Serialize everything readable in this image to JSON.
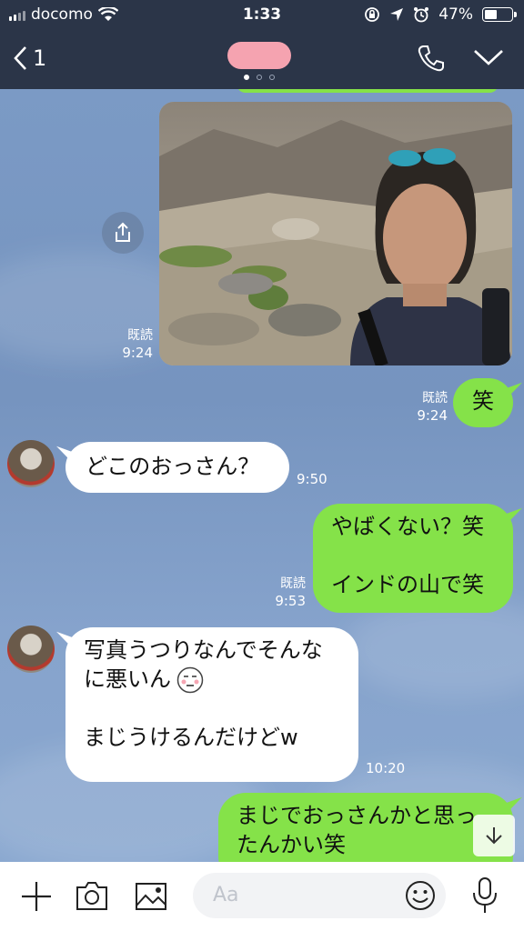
{
  "status_bar": {
    "carrier": "docomo",
    "time": "1:33",
    "battery": "47%",
    "battery_level": 0.47
  },
  "header": {
    "back_count": "1",
    "page_indicator": {
      "count": 3,
      "active": 0
    }
  },
  "messages": [
    {
      "type": "image",
      "side": "right",
      "read_label": "既読",
      "time": "9:24"
    },
    {
      "side": "right",
      "text": "笑",
      "read_label": "既読",
      "time": "9:24"
    },
    {
      "side": "left",
      "text": "どこのおっさん？",
      "time": "9:50"
    },
    {
      "side": "right",
      "lines": [
        "やばくない？笑",
        "",
        "インドの山で笑"
      ],
      "read_label": "既読",
      "time": "9:53"
    },
    {
      "side": "left",
      "lines": [
        "写真うつりなんでそんな",
        "に悪いん",
        "",
        "まじうけるんだけどw"
      ],
      "time": "10:20"
    },
    {
      "side": "right",
      "lines": [
        "まじでおっさんかと思っ",
        "たんかい笑"
      ]
    }
  ],
  "input": {
    "placeholder": "Aa"
  },
  "icons": {
    "back": "chevron-left-icon",
    "call": "phone-icon",
    "menu": "chevron-down-icon",
    "share": "share-icon",
    "scroll": "arrow-down-icon",
    "plus": "plus-icon",
    "camera": "camera-icon",
    "image": "image-icon",
    "emoji": "smiley-icon",
    "mic": "microphone-icon"
  },
  "colors": {
    "header_bg": "#2b3548",
    "chat_bg": "#7b99c3",
    "sent_bubble": "#85e249",
    "received_bubble": "#ffffff"
  }
}
